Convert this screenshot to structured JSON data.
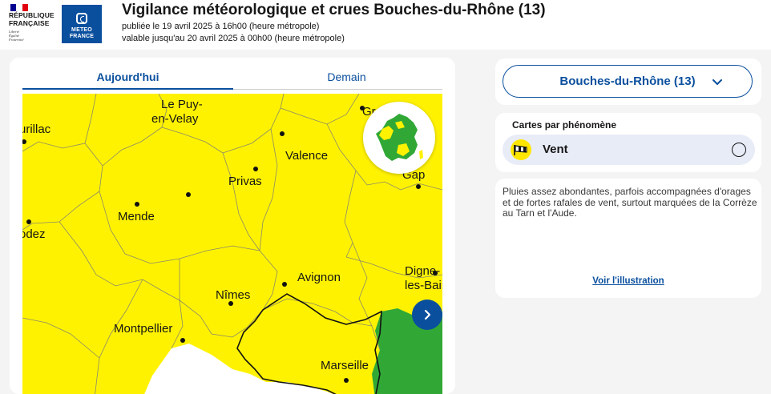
{
  "header": {
    "gov_logo_name": "RÉPUBLIQUE\nFRANÇAISE",
    "gov_motto": "Liberté\nÉgalité\nFraternité",
    "mf_logo_text": "METEO\nFRANCE",
    "title": "Vigilance météorologique et crues Bouches-du-Rhône (13)",
    "published": "publiée le 19 avril 2025 à 16h00 (heure métropole)",
    "valid_until": "valable jusqu'au 20 avril 2025 à 00h00 (heure métropole)"
  },
  "tabs": [
    {
      "label": "Aujourd'hui",
      "active": true
    },
    {
      "label": "Demain",
      "active": false
    }
  ],
  "map": {
    "vigilance_colors": {
      "yellow": "#fff200",
      "green": "#31a836"
    },
    "cities": [
      {
        "name": "urillac"
      },
      {
        "name": "Le Puy-"
      },
      {
        "name": "en-Velay"
      },
      {
        "name": "Gre"
      },
      {
        "name": "Valence"
      },
      {
        "name": "Privas"
      },
      {
        "name": "Gap"
      },
      {
        "name": "Mende"
      },
      {
        "name": "odez"
      },
      {
        "name": "Digne-"
      },
      {
        "name": "les-Bains"
      },
      {
        "name": "Avignon"
      },
      {
        "name": "Nîmes"
      },
      {
        "name": "Montpellier"
      },
      {
        "name": "Marseille"
      }
    ]
  },
  "department_select": {
    "value": "Bouches-du-Rhône (13)"
  },
  "phenomena": {
    "title": "Cartes par phénomène",
    "items": [
      {
        "label": "Vent",
        "icon": "wind-sock-icon"
      }
    ]
  },
  "description": {
    "text": "Pluies assez abondantes, parfois accompagnées d'orages et de fortes rafales de vent, surtout marquées de la Corrèze au Tarn et l'Aude.",
    "link": "Voir l'illustration"
  }
}
